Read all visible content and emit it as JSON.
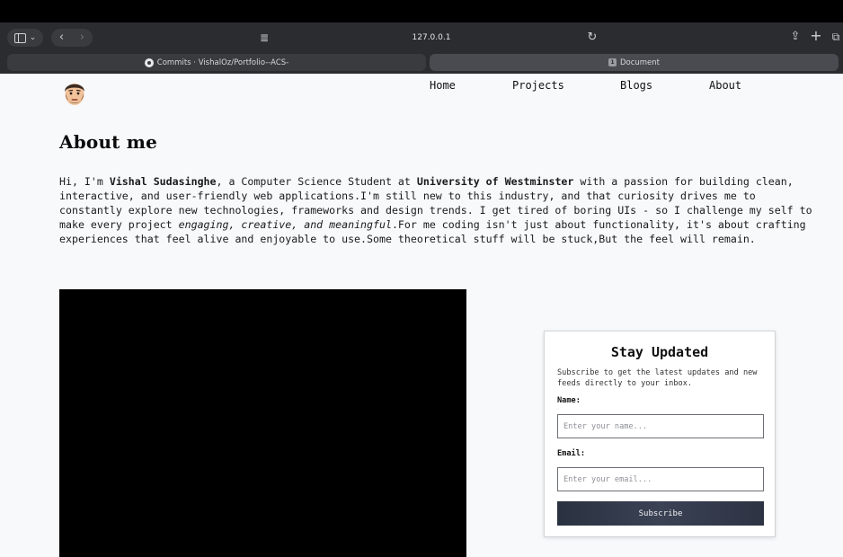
{
  "browser": {
    "address": "127.0.0.1",
    "tabs": [
      {
        "label": "Commits · VishalOz/Portfolio--ACS-"
      },
      {
        "label": "Document",
        "badge": "1"
      }
    ],
    "icons": {
      "sidebar": "sidebar-icon",
      "back": "‹",
      "forward": "›",
      "reader": "≣",
      "reload": "↻",
      "share": "⇪",
      "new_tab": "+",
      "tabs_overview": "⧉"
    }
  },
  "nav": {
    "links": [
      "Home",
      "Projects",
      "Blogs",
      "About"
    ]
  },
  "about": {
    "title": "About me",
    "intro": "Hi, I'm ",
    "name": "Vishal Sudasinghe",
    "mid1": ", a Computer Science Student at ",
    "university": "University of Westminster",
    "mid2": " with a passion for building clean, interactive, and user-friendly web applications.I'm still new to this industry, and that curiosity drives me to constantly explore new technologies, frameworks and design trends. I get tired of boring UIs - so I challenge my self to make every project ",
    "emphasis": "engaging, creative, and meaningful",
    "tail": ".For me coding isn't just about functionality, it's about crafting experiences that feel alive and enjoyable to use.Some theoretical stuff will be stuck,But the feel will remain."
  },
  "subscribe": {
    "title": "Stay Updated",
    "description": "Subscribe to get the latest updates and new feeds directly to your inbox.",
    "name_label": "Name:",
    "name_placeholder": "Enter your name...",
    "email_label": "Email:",
    "email_placeholder": "Enter your email...",
    "button_label": "Subscribe"
  },
  "colors": {
    "page_bg": "#f8f9fb",
    "chrome_bg": "#2b2c2f",
    "button_gradient_start": "#2a3140",
    "video_bg": "#000000"
  }
}
